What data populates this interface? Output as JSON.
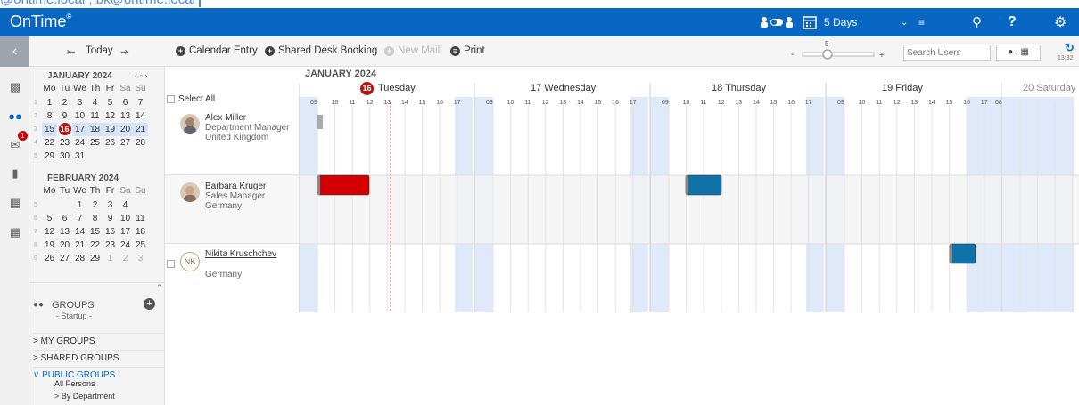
{
  "url_fragment": "@ontime.local ; bk@ontime.local",
  "app": {
    "logo": "OnTime",
    "logo_mark": "®",
    "view_select": "5 Days"
  },
  "toolbar": {
    "today": "Today",
    "calendar_entry": "Calendar Entry",
    "shared_desk": "Shared Desk Booking",
    "new_mail": "New Mail",
    "print": "Print",
    "zoom_value": "5",
    "search_placeholder": "Search Users",
    "time": "13:32"
  },
  "sidebar": {
    "mail_badge": "1"
  },
  "calendars": [
    {
      "title": "JANUARY 2024",
      "weekdays": [
        "Mo",
        "Tu",
        "We",
        "Th",
        "Fr",
        "Sa",
        "Su"
      ],
      "weeks": [
        [
          "1",
          "1",
          "2",
          "3",
          "4",
          "5",
          "6",
          "7"
        ],
        [
          "2",
          "8",
          "9",
          "10",
          "11",
          "12",
          "13",
          "14"
        ],
        [
          "3",
          "15",
          "16",
          "17",
          "18",
          "19",
          "20",
          "21"
        ],
        [
          "4",
          "22",
          "23",
          "24",
          "25",
          "26",
          "27",
          "28"
        ],
        [
          "5",
          "29",
          "30",
          "31",
          "",
          "",
          "",
          ""
        ]
      ]
    },
    {
      "title": "FEBRUARY 2024",
      "weekdays": [
        "Mo",
        "Tu",
        "We",
        "Th",
        "Fr",
        "Sa",
        "Su"
      ],
      "weeks": [
        [
          "5",
          "",
          "",
          "1",
          "2",
          "3",
          "4",
          ""
        ],
        [
          "6",
          "5",
          "6",
          "7",
          "8",
          "9",
          "10",
          "11"
        ],
        [
          "7",
          "12",
          "13",
          "14",
          "15",
          "16",
          "17",
          "18"
        ],
        [
          "8",
          "19",
          "20",
          "21",
          "22",
          "23",
          "24",
          "25"
        ],
        [
          "9",
          "26",
          "27",
          "28",
          "29",
          "1",
          "2",
          "3"
        ]
      ]
    }
  ],
  "groups": {
    "title": "GROUPS",
    "subtitle": "- Startup -",
    "items": [
      "> MY GROUPS",
      "> SHARED GROUPS",
      "∨ PUBLIC GROUPS"
    ],
    "sub_items": [
      "All Persons",
      "> By Department"
    ]
  },
  "people": {
    "select_all": "Select All",
    "rows": [
      {
        "name": "Alex Miller",
        "title": "Department Manager",
        "country": "United Kingdom"
      },
      {
        "name": "Barbara Kruger",
        "title": "Sales Manager",
        "country": "Germany"
      },
      {
        "name": "Nikita Kruschchev",
        "title": "",
        "country": "Germany",
        "initials": "NK"
      }
    ]
  },
  "grid": {
    "month": "JANUARY 2024",
    "today_num": "16",
    "days": [
      {
        "label": "Tuesday"
      },
      {
        "label": "17 Wednesday"
      },
      {
        "label": "18 Thursday"
      },
      {
        "label": "19 Friday"
      },
      {
        "label": "20 Saturday"
      }
    ],
    "hours": [
      "09",
      "10",
      "11",
      "12",
      "13",
      "14",
      "15",
      "16",
      "17"
    ],
    "last_hour": "08"
  },
  "colors": {
    "brand": "#0967c4",
    "today_red": "#b01515",
    "event_red": "#d40000",
    "event_blue": "#0f72a8",
    "offhours": "#dfe9f9"
  }
}
